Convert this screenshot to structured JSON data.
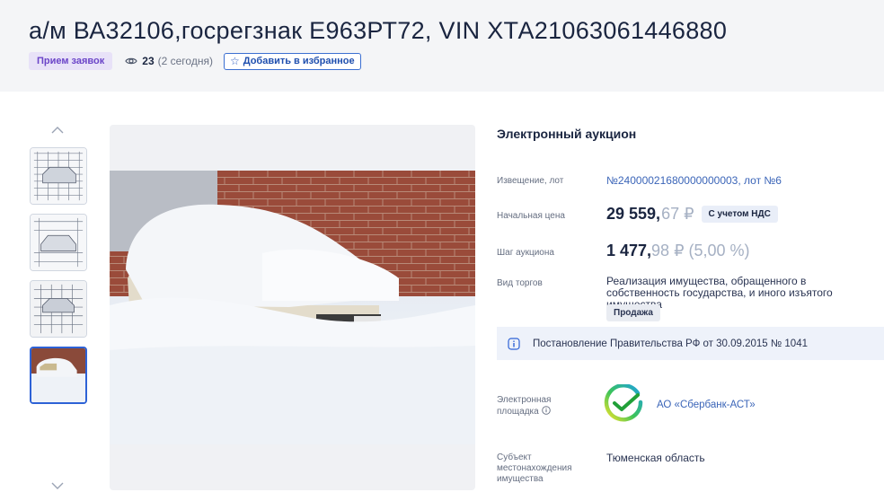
{
  "header": {
    "title": "а/м ВА32106,госрегзнак Е963РТ72, VIN ХТА21063061446880",
    "status_badge": "Прием заявок",
    "views_count": "23",
    "views_today": "(2 сегодня)",
    "favorite_button": "Добавить в избранное"
  },
  "gallery": {
    "thumbnails": [
      "thumb-1",
      "thumb-2",
      "thumb-3",
      "thumb-4"
    ],
    "active_index": 3
  },
  "details": {
    "auction_type": "Электронный аукцион",
    "notice_label": "Извещение, лот",
    "notice_value": "№24000021680000000003, лот №6",
    "start_price_label": "Начальная цена",
    "start_price_int": "29 559,",
    "start_price_frac": "67 ₽",
    "vat_badge": "С учетом НДС",
    "step_label": "Шаг аукциона",
    "step_int": "1 477,",
    "step_frac": "98 ₽ (5,00 %)",
    "trade_type_label": "Вид торгов",
    "trade_type_value": "Реализация имущества, обращенного в собственность государства, и иного изъятого имущества",
    "sale_badge": "Продажа",
    "decree": "Постановление Правительства РФ от 30.09.2015 № 1041",
    "platform_label_1": "Электронная",
    "platform_label_2": "площадка",
    "platform_name": "АО «Сбербанк-АСТ»",
    "region_label_1": "Субъект",
    "region_label_2": "местонахождения",
    "region_label_3": "имущества",
    "region_value": "Тюменская область"
  },
  "colors": {
    "accent": "#2d62d6",
    "status_purple": "#6b45c8",
    "header_bg": "#f4f5f7"
  }
}
